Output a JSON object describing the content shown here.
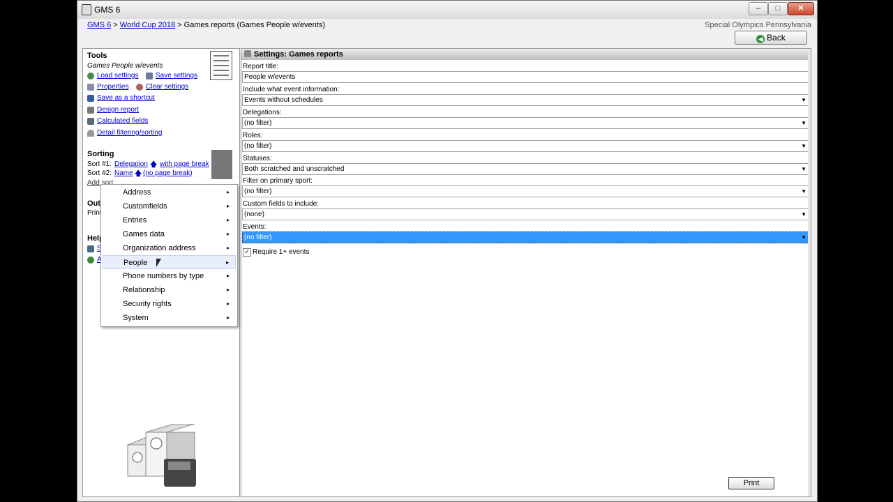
{
  "window": {
    "title": "GMS 6",
    "minimize": "–",
    "maximize": "□",
    "close": "✕"
  },
  "breadcrumb": {
    "items": [
      "GMS 6",
      "World Cup 2018"
    ],
    "separator": ">",
    "current": "Games reports (Games People w/events)"
  },
  "organization": "Special Olympics Pennsylvania",
  "back_button": "Back",
  "sidebar": {
    "tools": {
      "heading": "Tools",
      "subtitle": "Games People w/events",
      "links": {
        "load": "Load settings",
        "save": "Save settings",
        "properties": "Properties",
        "clear": "Clear settings",
        "shortcut": "Save as a shortcut",
        "design": "Design report",
        "calculated": "Calculated fields",
        "filtering": "Detail filtering/sorting"
      }
    },
    "sorting": {
      "heading": "Sorting",
      "sort1_prefix": "Sort #1:",
      "sort1_field": "Delegation",
      "sort1_break": "with page break",
      "sort2_prefix": "Sort #2:",
      "sort2_field": "Name",
      "sort2_break": "(no page break)",
      "add_sort": "Add sort"
    },
    "output": {
      "heading_partial": "Outp",
      "text_partial": "Print"
    },
    "help": {
      "heading_partial": "Help",
      "link1_partial": "S",
      "link2_partial": "A"
    }
  },
  "settings": {
    "header": "Settings: Games reports",
    "fields": [
      {
        "label": "Report title:",
        "value": "People w/events",
        "dropdown": false
      },
      {
        "label": "Include what event information:",
        "value": "Events without schedules",
        "dropdown": true
      },
      {
        "label": "Delegations:",
        "value": "(no filter)",
        "dropdown": true
      },
      {
        "label": "Roles:",
        "value": "(no filter)",
        "dropdown": true
      },
      {
        "label": "Statuses:",
        "value": "Both scratched and unscratched",
        "dropdown": true
      },
      {
        "label": "Filter on primary sport:",
        "value": "(no filter)",
        "dropdown": true
      },
      {
        "label": "Custom fields to include:",
        "value": "(none)",
        "dropdown": true
      },
      {
        "label": "Events:",
        "value": "(no filter)",
        "dropdown": true
      }
    ],
    "dropdown_arrow": "▼",
    "checkbox": {
      "label": "Require 1+ events",
      "checked": true,
      "mark": "✓"
    },
    "print_button": "Print"
  },
  "context_menu": {
    "items": [
      "Address",
      "Customfields",
      "Entries",
      "Games data",
      "Organization address",
      "People",
      "Phone numbers by type",
      "Relationship",
      "Security rights",
      "System"
    ],
    "hovered": "People",
    "submenu_arrow": "▸"
  },
  "icons": {
    "sort_arrow": "🡅"
  },
  "colors": {
    "link": "#0000cc",
    "selection": "#3399ff",
    "menu_hover": "#e8eefb"
  }
}
